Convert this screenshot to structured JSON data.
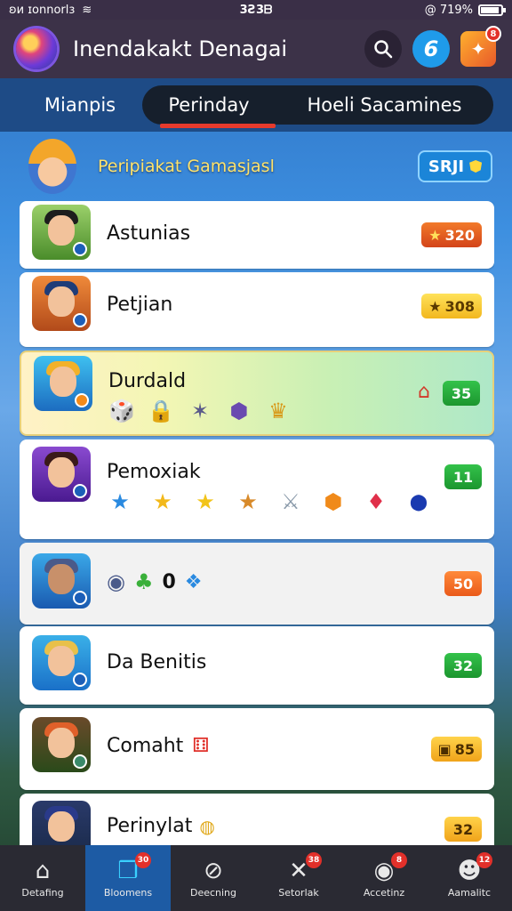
{
  "status_bar": {
    "left_text": "ʚᴎ ɪonnorlɜ",
    "time": "3Ƨ3ᗷ",
    "right_text": "@ 719%",
    "battery_level": 0.85
  },
  "header": {
    "title": "Inendakakt Denagai",
    "social_label": "6",
    "game_badge": "8"
  },
  "tabs": [
    {
      "label": "Mianpis"
    },
    {
      "label": "Perinday"
    },
    {
      "label": "Hoeli Sacamines"
    }
  ],
  "banner": {
    "text": "Peripiakat Gamasjasl",
    "button_label": "SRJI"
  },
  "rows": [
    {
      "name": "Astunias",
      "score": "320",
      "score_icon": "★"
    },
    {
      "name": "Petjian",
      "score": "308",
      "score_icon": "★"
    },
    {
      "name": "Durdald",
      "score": "35",
      "score_icon": "⌂"
    },
    {
      "name": "Pemoxiak",
      "score": "11"
    },
    {
      "name": "0",
      "score": "50"
    },
    {
      "name": "Da Benitis",
      "score": "32"
    },
    {
      "name": "Comaht",
      "score": "85",
      "score_icon": "▣"
    },
    {
      "name": "Perinylat",
      "score": "32"
    }
  ],
  "row3_icons": [
    "🎲",
    "🔒",
    "✶",
    "⬢",
    "♛"
  ],
  "row4_icons": [
    "★",
    "★",
    "★",
    "★",
    "⚔",
    "⬢",
    "♦",
    "⬤"
  ],
  "bottom_nav": [
    {
      "label": "Detafing",
      "icon": "⌂"
    },
    {
      "label": "Bloomens",
      "icon": "❒",
      "badge": "30"
    },
    {
      "label": "Deecning",
      "icon": "⊘"
    },
    {
      "label": "Setorlak",
      "icon": "✕",
      "badge": "38"
    },
    {
      "label": "Accetinz",
      "icon": "◉",
      "badge": "8"
    },
    {
      "label": "Aamalitc",
      "icon": "☻",
      "badge": "12"
    }
  ]
}
